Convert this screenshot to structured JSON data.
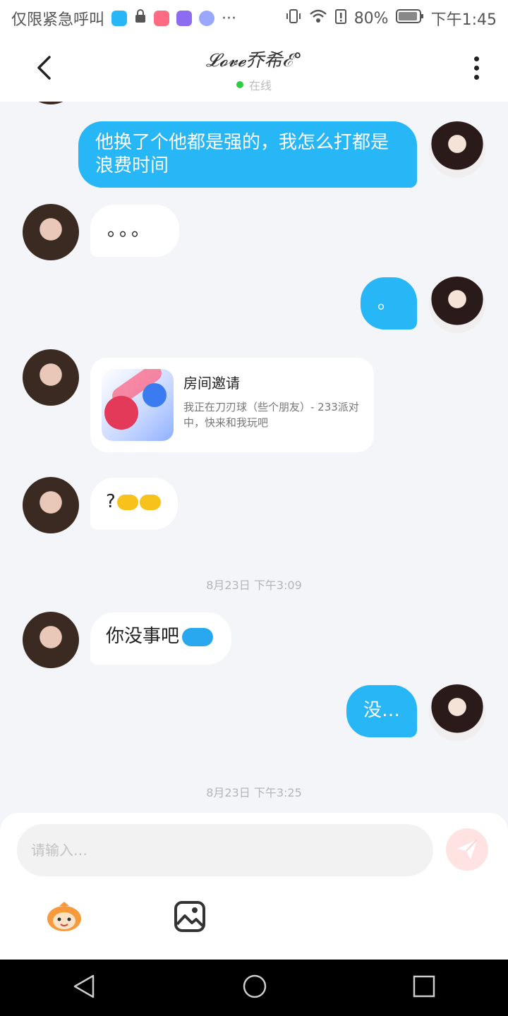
{
  "status_bar": {
    "left_text": "仅限紧急呼叫",
    "overflow": "···",
    "battery": "80%",
    "time": "下午1:45"
  },
  "header": {
    "title": "𝓛𝓸𝓿𝓮乔希ℰ°",
    "status": "在线"
  },
  "messages": [
    {
      "side": "me",
      "text": "他换了个他都是强的，我怎么打都是浪费时间"
    },
    {
      "side": "them",
      "text": "。。。"
    },
    {
      "side": "me",
      "text": "。"
    },
    {
      "side": "them",
      "type": "invite",
      "title": "房间邀请",
      "description": "我正在刀刃球（些个朋友）- 233派对中，快来和我玩吧"
    },
    {
      "side": "them",
      "text": "?"
    },
    {
      "type": "timestamp",
      "text": "8月23日 下午3:09"
    },
    {
      "side": "them",
      "text": "你没事吧"
    },
    {
      "side": "me",
      "text": "没…"
    },
    {
      "type": "timestamp",
      "text": "8月23日 下午3:25"
    }
  ],
  "input": {
    "placeholder": "请输入…"
  },
  "colors": {
    "my_bubble": "#27b6f6",
    "their_bubble": "#ffffff",
    "background": "#f3f5f8",
    "online_dot": "#2ecc40"
  },
  "icons": {
    "back": "back-arrow-icon",
    "more": "more-vertical-icon",
    "send": "send-icon",
    "sticker": "sticker-icon",
    "image": "image-icon",
    "nav_back": "nav-back-icon",
    "nav_home": "nav-home-icon",
    "nav_recent": "nav-recent-icon"
  }
}
